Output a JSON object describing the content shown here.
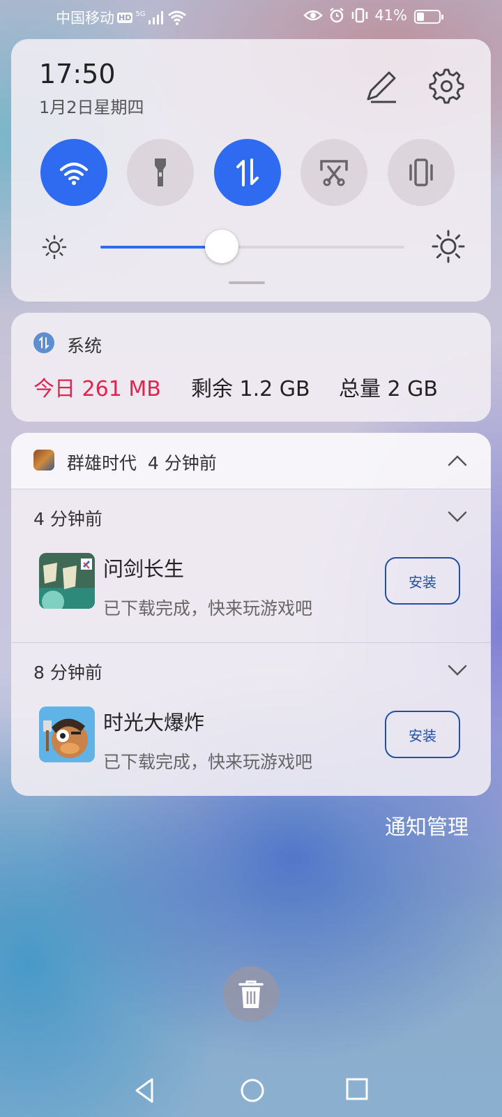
{
  "status_bar": {
    "carrier": "中国移动",
    "hd": "HD",
    "network": "5G",
    "battery": "41%",
    "battery_level": 0.41
  },
  "quick_settings": {
    "time": "17:50",
    "date": "1月2日星期四",
    "toggles": [
      {
        "name": "wifi",
        "icon": "wifi-icon",
        "on": true
      },
      {
        "name": "flashlight",
        "icon": "flashlight-icon",
        "on": false
      },
      {
        "name": "mobile-data",
        "icon": "mobile-data-icon",
        "on": true
      },
      {
        "name": "screenshot",
        "icon": "scissors-screenshot-icon",
        "on": false
      },
      {
        "name": "vibrate",
        "icon": "vibrate-icon",
        "on": false
      }
    ],
    "brightness": 0.4,
    "accent_color": "#2e6bf0"
  },
  "data_usage": {
    "title": "系统",
    "today": "今日 261 MB",
    "remaining": "剩余 1.2 GB",
    "total": "总量 2 GB",
    "today_color": "#e0244e"
  },
  "notifications": {
    "app_name": "群雄时代",
    "time_ago": "4 分钟前",
    "items": [
      {
        "time": "4 分钟前",
        "title": "问剑长生",
        "desc": "已下载完成，快来玩游戏吧",
        "button": "安装"
      },
      {
        "time": "8 分钟前",
        "title": "时光大爆炸",
        "desc": "已下载完成，快来玩游戏吧",
        "button": "安装"
      }
    ]
  },
  "notification_manage": "通知管理"
}
